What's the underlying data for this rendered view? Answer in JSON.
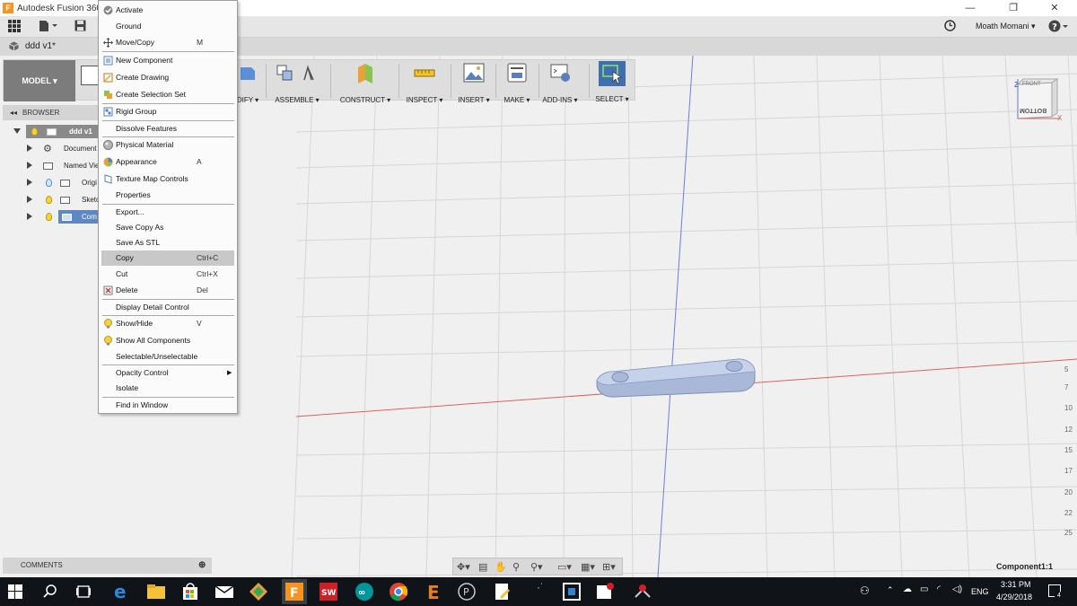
{
  "window": {
    "title": "Autodesk Fusion 360 (E",
    "minimize_glyph": "—",
    "restore_glyph": "❐",
    "close_glyph": "✕"
  },
  "quick_access": {
    "user_name": "Moath Momani ▾",
    "help_glyph": "?"
  },
  "document": {
    "tab_title": "ddd v1*"
  },
  "toolbar": {
    "workspace": "MODEL ▾",
    "groups": [
      "DIFY ▾",
      "ASSEMBLE ▾",
      "CONSTRUCT ▾",
      "INSPECT ▾",
      "INSERT ▾",
      "MAKE ▾",
      "ADD-INS ▾",
      "SELECT ▾"
    ]
  },
  "browser": {
    "header": "BROWSER",
    "root": "ddd v1",
    "items": [
      "Document",
      "Named Vie",
      "Origi",
      "Sketc",
      "Com"
    ]
  },
  "comments": {
    "label": "COMMENTS"
  },
  "context_menu": {
    "items": [
      {
        "label": "Activate",
        "shortcut": "",
        "icon": "check-circle-icon"
      },
      {
        "label": "Ground",
        "shortcut": "",
        "icon": ""
      },
      {
        "label": "Move/Copy",
        "shortcut": "M",
        "icon": "move-icon"
      },
      {
        "label": "New Component",
        "shortcut": "",
        "icon": "component-icon"
      },
      {
        "label": "Create Drawing",
        "shortcut": "",
        "icon": "drawing-icon"
      },
      {
        "label": "Create Selection Set",
        "shortcut": "",
        "icon": "selection-set-icon"
      },
      {
        "label": "Rigid Group",
        "shortcut": "",
        "icon": "rigid-group-icon"
      },
      {
        "label": "Dissolve Features",
        "shortcut": "",
        "icon": ""
      },
      {
        "label": "Physical Material",
        "shortcut": "",
        "icon": "material-icon"
      },
      {
        "label": "Appearance",
        "shortcut": "A",
        "icon": "appearance-icon"
      },
      {
        "label": "Texture Map Controls",
        "shortcut": "",
        "icon": "texture-icon"
      },
      {
        "label": "Properties",
        "shortcut": "",
        "icon": ""
      },
      {
        "label": "Export...",
        "shortcut": "",
        "icon": ""
      },
      {
        "label": "Save Copy As",
        "shortcut": "",
        "icon": ""
      },
      {
        "label": "Save As STL",
        "shortcut": "",
        "icon": ""
      },
      {
        "label": "Copy",
        "shortcut": "Ctrl+C",
        "icon": ""
      },
      {
        "label": "Cut",
        "shortcut": "Ctrl+X",
        "icon": ""
      },
      {
        "label": "Delete",
        "shortcut": "Del",
        "icon": "delete-icon"
      },
      {
        "label": "Display Detail Control",
        "shortcut": "",
        "icon": ""
      },
      {
        "label": "Show/Hide",
        "shortcut": "V",
        "icon": "bulb-icon"
      },
      {
        "label": "Show All Components",
        "shortcut": "",
        "icon": "bulb-icon"
      },
      {
        "label": "Selectable/Unselectable",
        "shortcut": "",
        "icon": ""
      },
      {
        "label": "Opacity Control",
        "shortcut": "",
        "icon": ""
      },
      {
        "label": "Isolate",
        "shortcut": "",
        "icon": ""
      },
      {
        "label": "Find in Window",
        "shortcut": "",
        "icon": ""
      }
    ],
    "highlighted": "Copy"
  },
  "viewcube": {
    "front": "FRONT",
    "bottom": "BOTTOM",
    "z": "Z",
    "x": "X"
  },
  "ruler": {
    "marks": [
      "5",
      "7",
      "10",
      "12",
      "15",
      "17",
      "20",
      "22",
      "25"
    ]
  },
  "status": {
    "component_label": "Component1:1"
  },
  "taskbar": {
    "time": "3:31 PM",
    "date": "4/29/2018",
    "lang": "ENG",
    "notif_count": "4"
  },
  "colors": {
    "axis_red": "#e06060",
    "axis_blue": "#6a7fe0",
    "highlight": "#c8c8c8",
    "part": "#b7c6e2"
  }
}
